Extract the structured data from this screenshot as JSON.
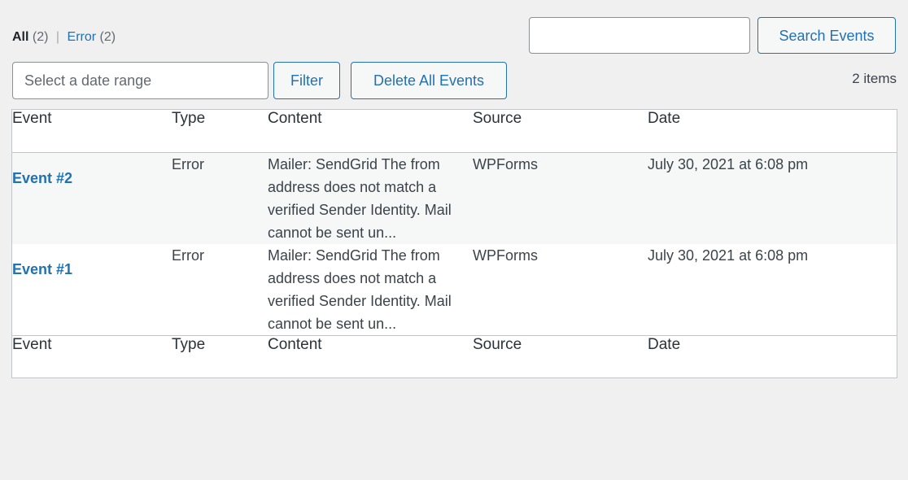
{
  "views": {
    "all": {
      "label": "All",
      "count": "(2)",
      "current": true
    },
    "separator": "|",
    "error": {
      "label": "Error",
      "count": "(2)",
      "current": false
    }
  },
  "search": {
    "value": "",
    "placeholder": "",
    "button_label": "Search Events"
  },
  "filters": {
    "date_range_value": "",
    "date_range_placeholder": "Select a date range",
    "filter_button_label": "Filter",
    "delete_all_button_label": "Delete All Events"
  },
  "item_count": "2 items",
  "table": {
    "columns": [
      "Event",
      "Type",
      "Content",
      "Source",
      "Date"
    ],
    "rows": [
      {
        "event": "Event #2",
        "type": "Error",
        "content": "Mailer: SendGrid The from address does not match a verified Sender Identity. Mail cannot be sent un...",
        "source": "WPForms",
        "date": "July 30, 2021 at 6:08 pm"
      },
      {
        "event": "Event #1",
        "type": "Error",
        "content": "Mailer: SendGrid The from address does not match a verified Sender Identity. Mail cannot be sent un...",
        "source": "WPForms",
        "date": "July 30, 2021 at 6:08 pm"
      }
    ]
  },
  "colors": {
    "page_background": "#f0f0f1",
    "link": "#2271b1",
    "text": "#3c434a",
    "heading": "#1d2327",
    "muted": "#646970",
    "border": "#c3c4c7",
    "input_border": "#8c8f94",
    "stripe": "#f6f7f7"
  }
}
